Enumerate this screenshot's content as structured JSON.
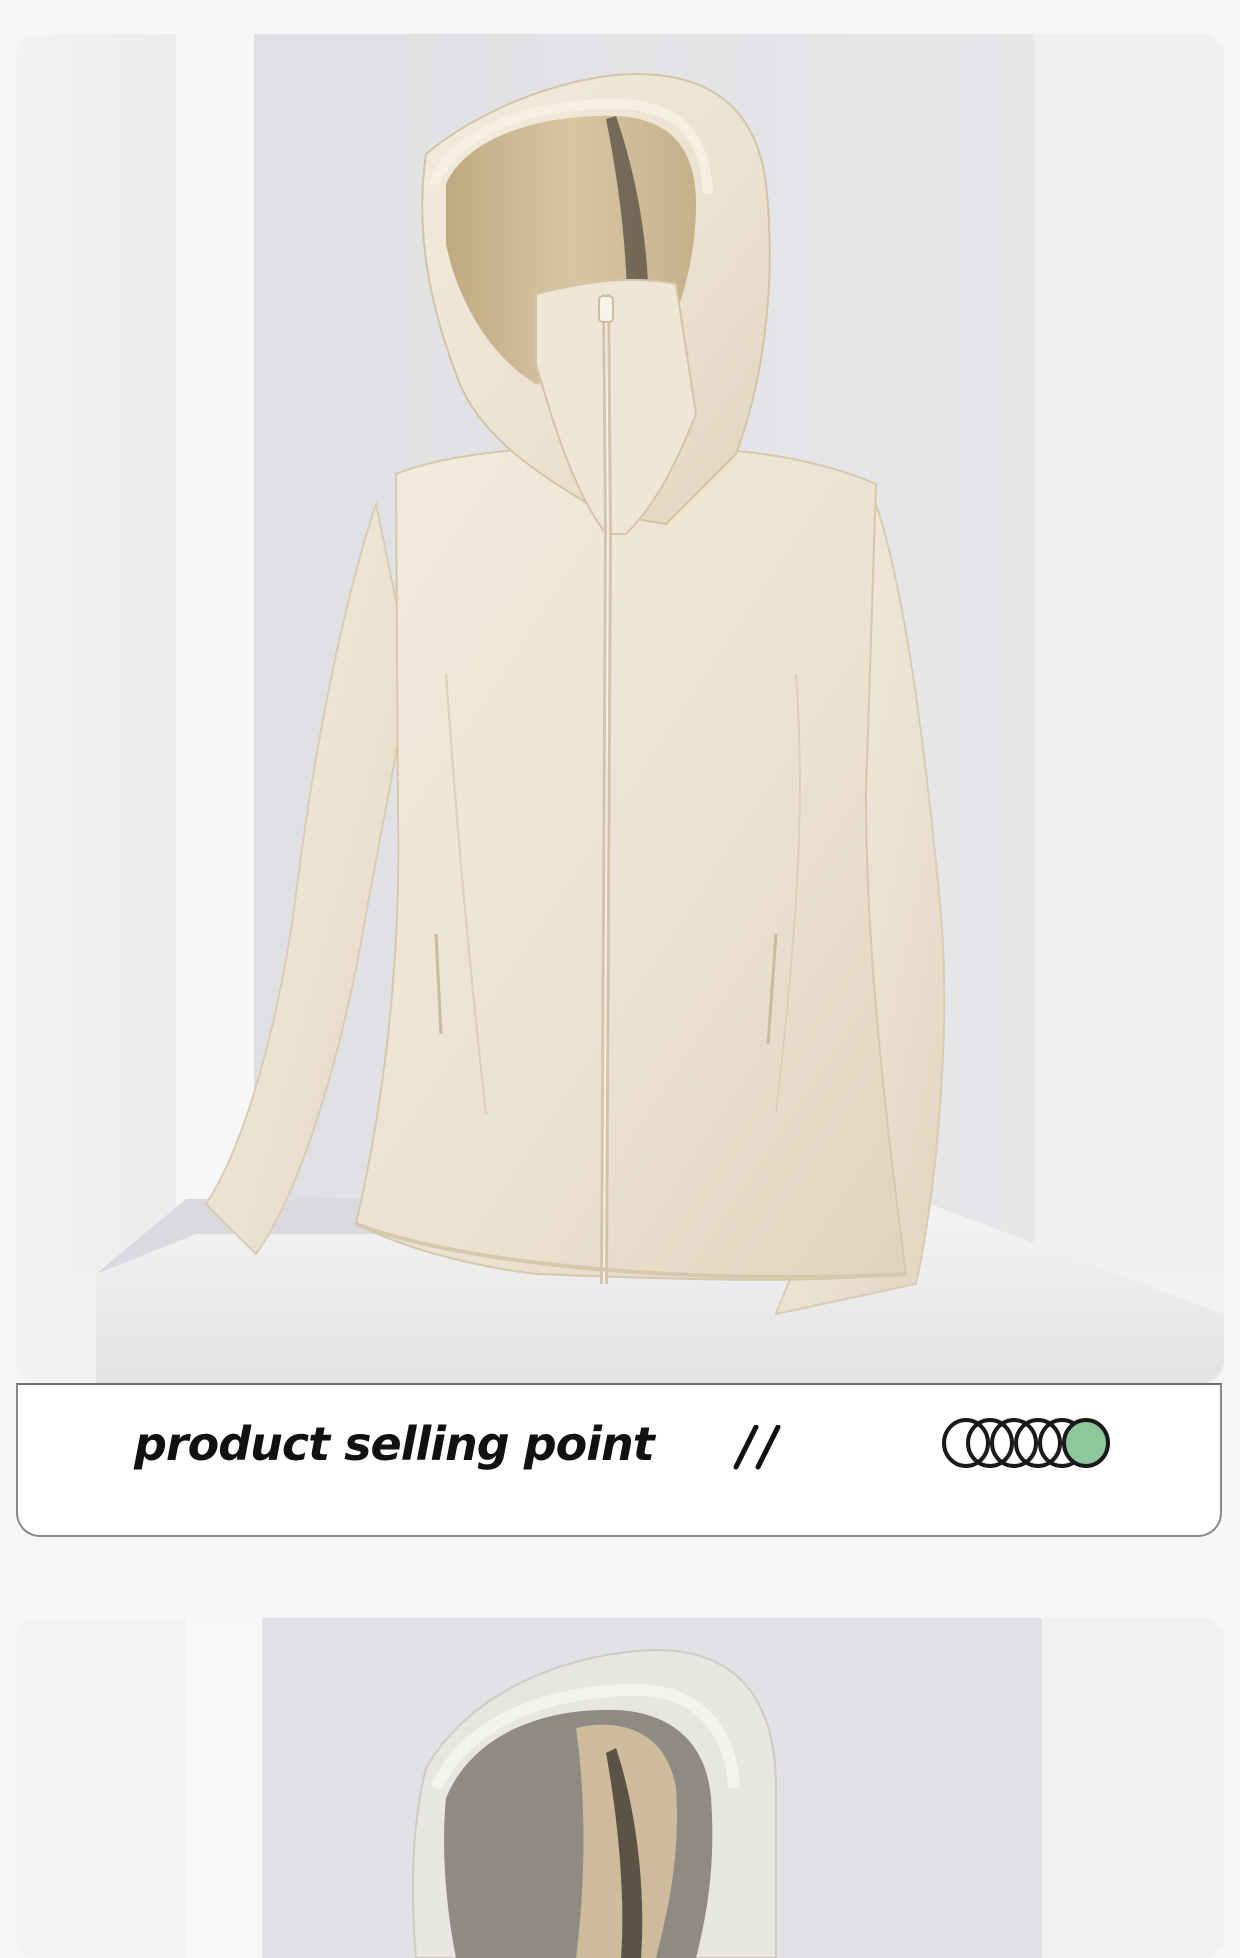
{
  "selling_point": {
    "label": "product selling point",
    "separator_icon": "double-slash",
    "indicator": {
      "total": 6,
      "active": 6,
      "active_color": "#8fc79c",
      "ring_color": "#1a1a1a"
    }
  },
  "colors": {
    "background": "#f6f6f6",
    "jacket_beige": "#eee4d3",
    "jacket_grey": "#e6e3de",
    "backdrop_grey": "#e4e4e6"
  }
}
